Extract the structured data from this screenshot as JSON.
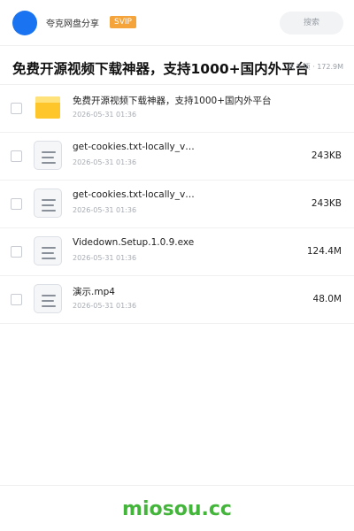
{
  "header": {
    "app_title": "夸克网盘分享",
    "badge": "SVIP",
    "search_placeholder": "搜索"
  },
  "share": {
    "title": "免费开源视频下载神器，支持1000+国内外平台",
    "meta": "共 5 项 · 172.9M"
  },
  "files": [
    {
      "name": "免费开源视频下载神器，支持1000+国内外平台",
      "date": "2026-05-31 01:36",
      "size": "",
      "type": "folder"
    },
    {
      "name": "get-cookies.txt-locally_v…",
      "date": "2026-05-31 01:36",
      "size": "243KB",
      "type": "file"
    },
    {
      "name": "get-cookies.txt-locally_v…",
      "date": "2026-05-31 01:36",
      "size": "243KB",
      "type": "file"
    },
    {
      "name": "Videdown.Setup.1.0.9.exe",
      "date": "2026-05-31 01:36",
      "size": "124.4M",
      "type": "file"
    },
    {
      "name": "演示.mp4",
      "date": "2026-05-31 01:36",
      "size": "48.0M",
      "type": "file"
    }
  ],
  "footer": {
    "brand": "miosou.cc"
  },
  "colors": {
    "accent_blue": "#1a73f0",
    "svip_orange": "#f4a43b",
    "folder_yellow": "#ffc62b",
    "brand_green": "#43b53a"
  },
  "icons": {
    "folder": "folder-icon",
    "file": "document-icon"
  }
}
